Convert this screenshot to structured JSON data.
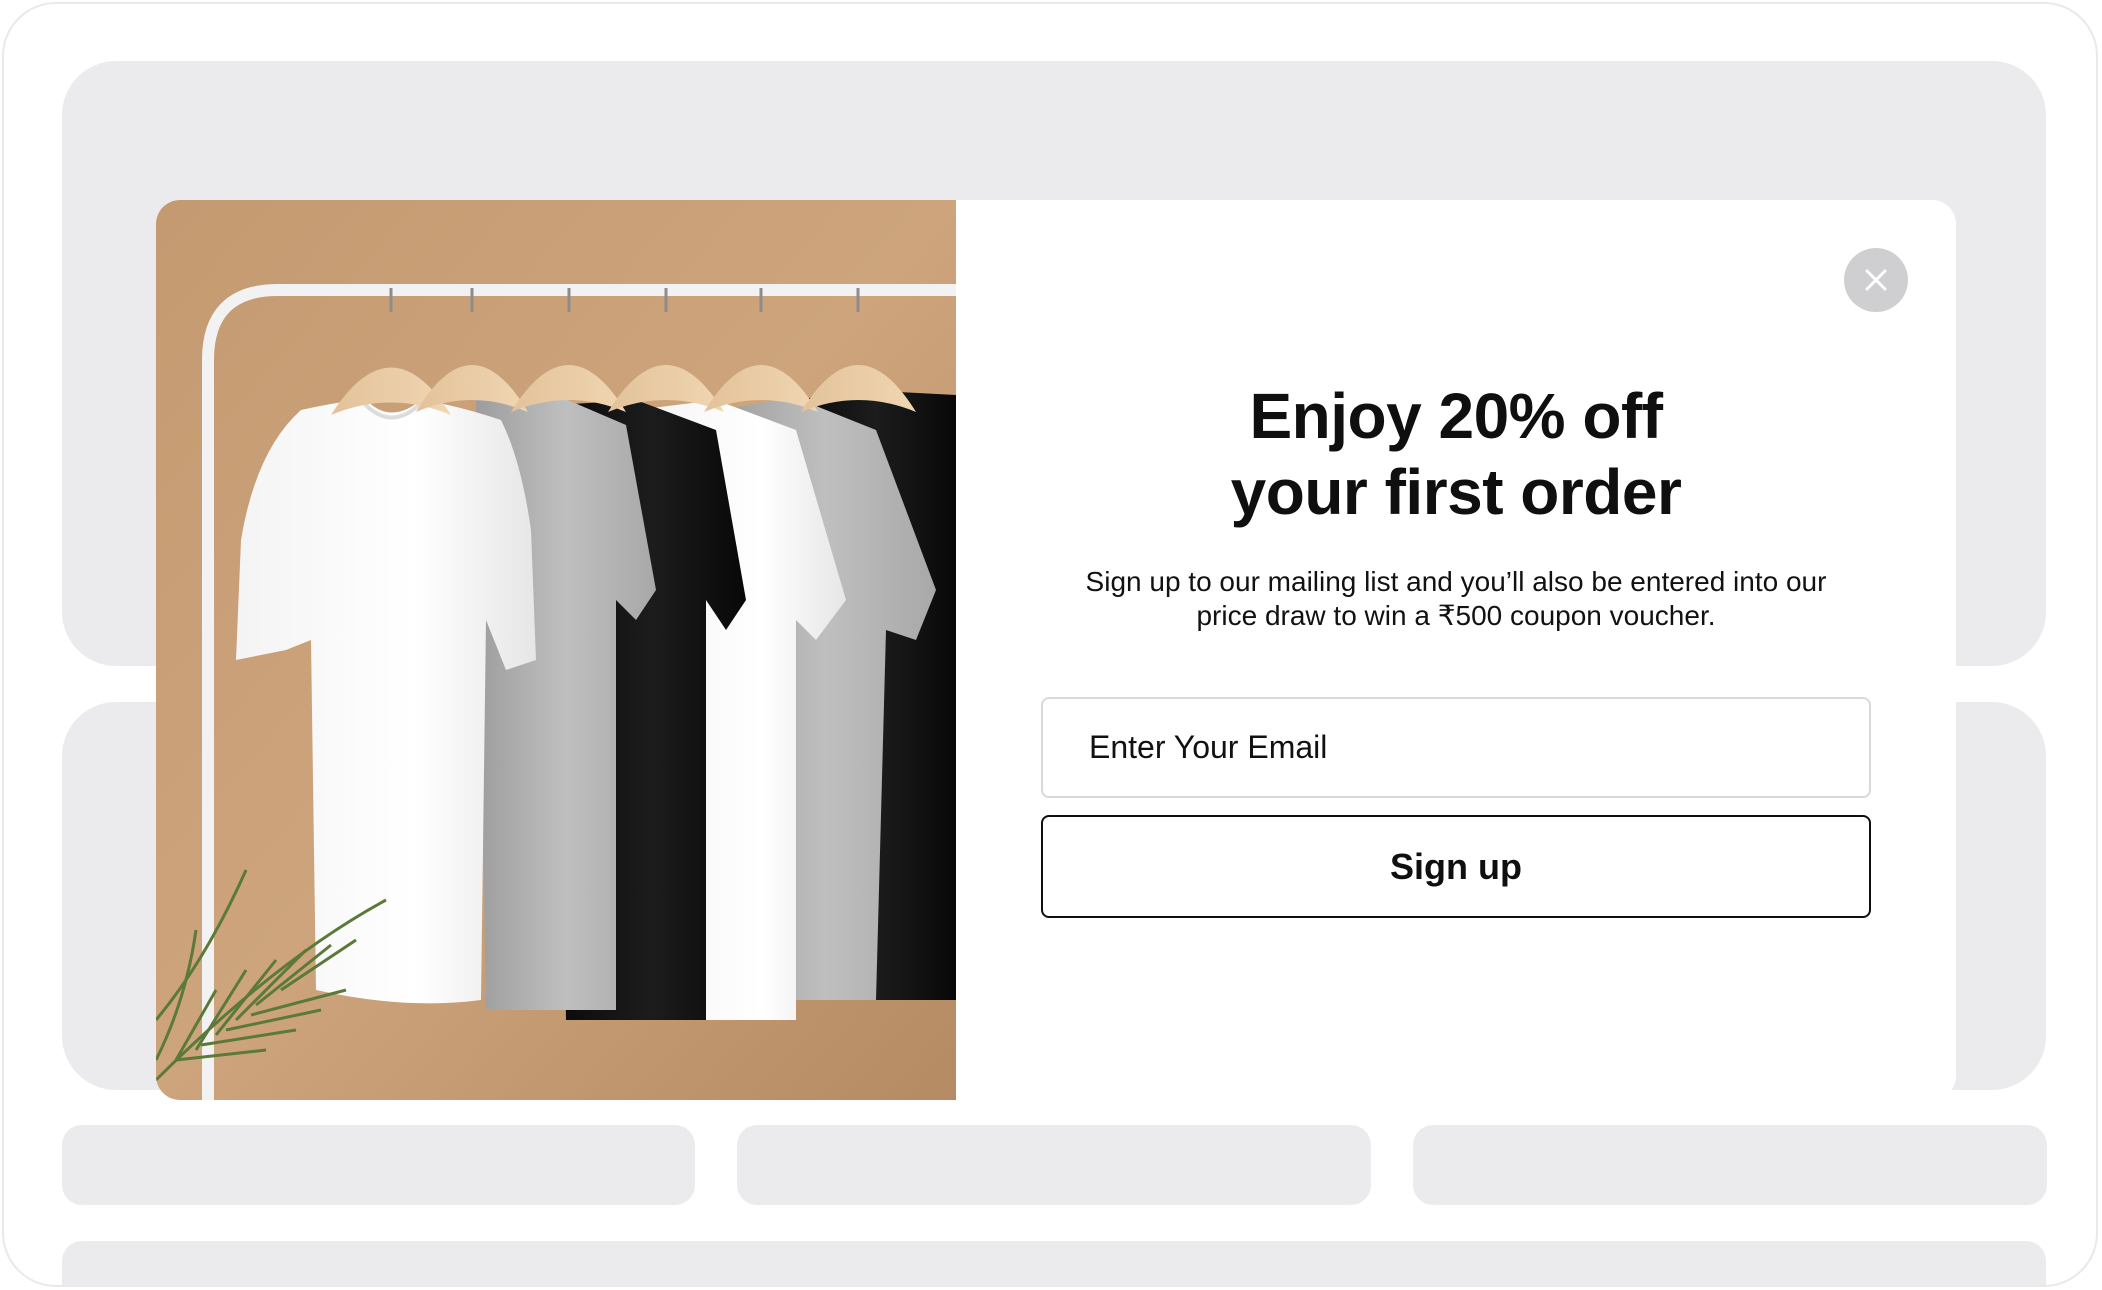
{
  "popup": {
    "headline_line1": "Enjoy 20% off",
    "headline_line2": "your first order",
    "subtext_line1": "Sign up to our mailing list and you’ll also be entered into our",
    "subtext_line2": "price draw to win a ₹500 coupon voucher.",
    "email_placeholder": "Enter Your Email",
    "email_value": "",
    "signup_label": "Sign up",
    "close_icon": "close-icon",
    "image_description_icon": "t-shirts-on-rack-photo"
  },
  "colors": {
    "background_placeholder": "#ebebed",
    "modal_background": "#ffffff",
    "photo_wall": "#c9a27b",
    "text_primary": "#0f0f10",
    "close_button": "#cfcfd1",
    "input_border": "#d9d9dc"
  }
}
